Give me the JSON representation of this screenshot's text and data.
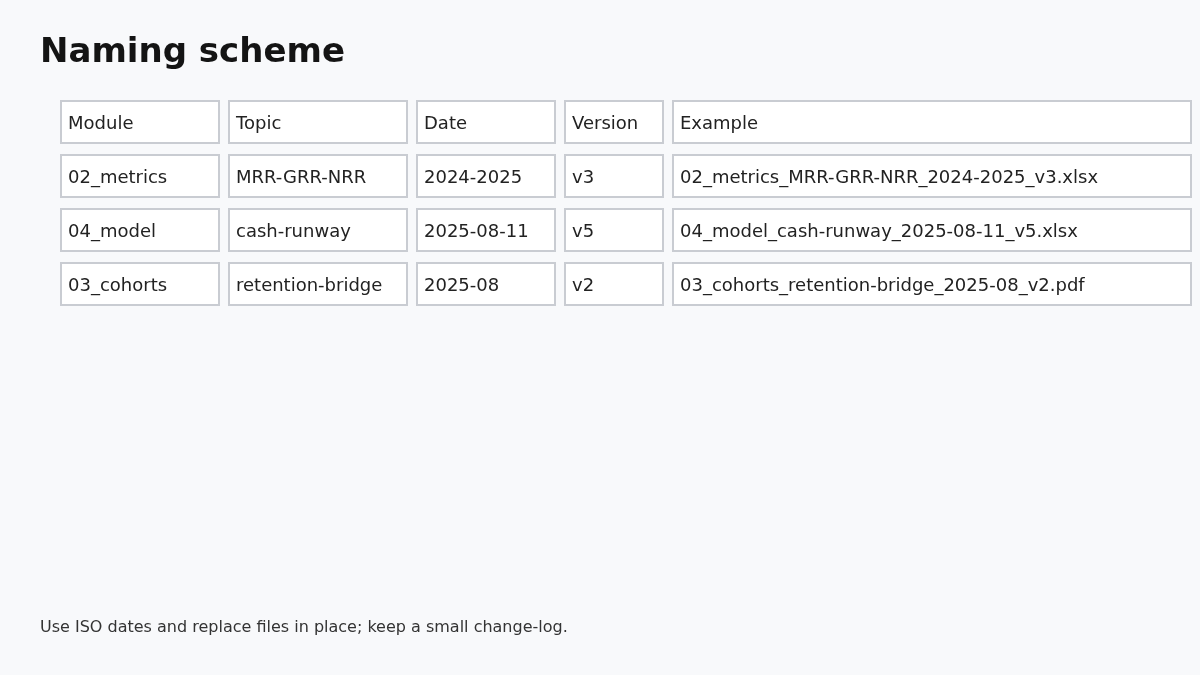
{
  "title": "Naming scheme",
  "table": {
    "columns": [
      "Module",
      "Topic",
      "Date",
      "Version",
      "Example"
    ],
    "rows": [
      [
        "02_metrics",
        "MRR-GRR-NRR",
        "2024-2025",
        "v3",
        "02_metrics_MRR-GRR-NRR_2024-2025_v3.xlsx"
      ],
      [
        "04_model",
        "cash-runway",
        "2025-08-11",
        "v5",
        "04_model_cash-runway_2025-08-11_v5.xlsx"
      ],
      [
        "03_cohorts",
        "retention-bridge",
        "2025-08",
        "v2",
        "03_cohorts_retention-bridge_2025-08_v2.pdf"
      ]
    ]
  },
  "footnote": "Use ISO dates and replace files in place; keep a small change-log."
}
